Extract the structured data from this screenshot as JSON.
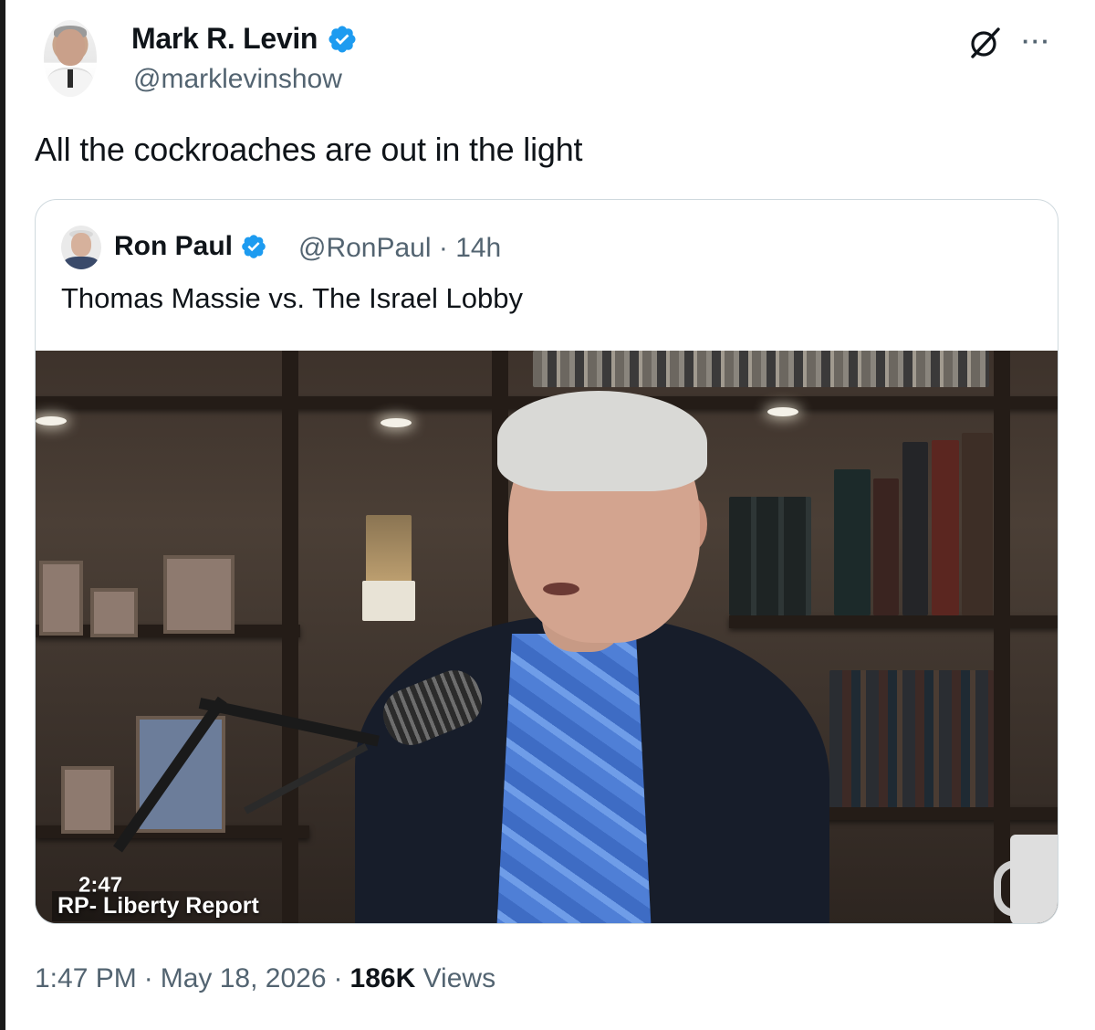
{
  "author": {
    "name": "Mark R. Levin",
    "handle": "@marklevinshow",
    "verified": true
  },
  "tweet": {
    "text": "All the cockroaches are out in the light"
  },
  "quoted": {
    "name": "Ron Paul",
    "handle_time": "@RonPaul · 14h",
    "verified": true,
    "text": "Thomas Massie vs. The Israel Lobby",
    "video": {
      "duration": "2:47",
      "channel": "RP- Liberty Report"
    }
  },
  "meta": {
    "time": "1:47 PM",
    "sep1": "·",
    "date": "May 18, 2026",
    "sep2": "·",
    "views_count": "186K",
    "views_label": "Views"
  },
  "icons": {
    "grok": "grok-icon",
    "more": "more-dots-icon",
    "verified": "verified-badge-icon"
  },
  "colors": {
    "verified_blue": "#1d9bf0",
    "secondary_text": "#536471",
    "primary_text": "#0f1419",
    "card_border": "#cfd9de"
  },
  "controls": {
    "more": "···"
  }
}
